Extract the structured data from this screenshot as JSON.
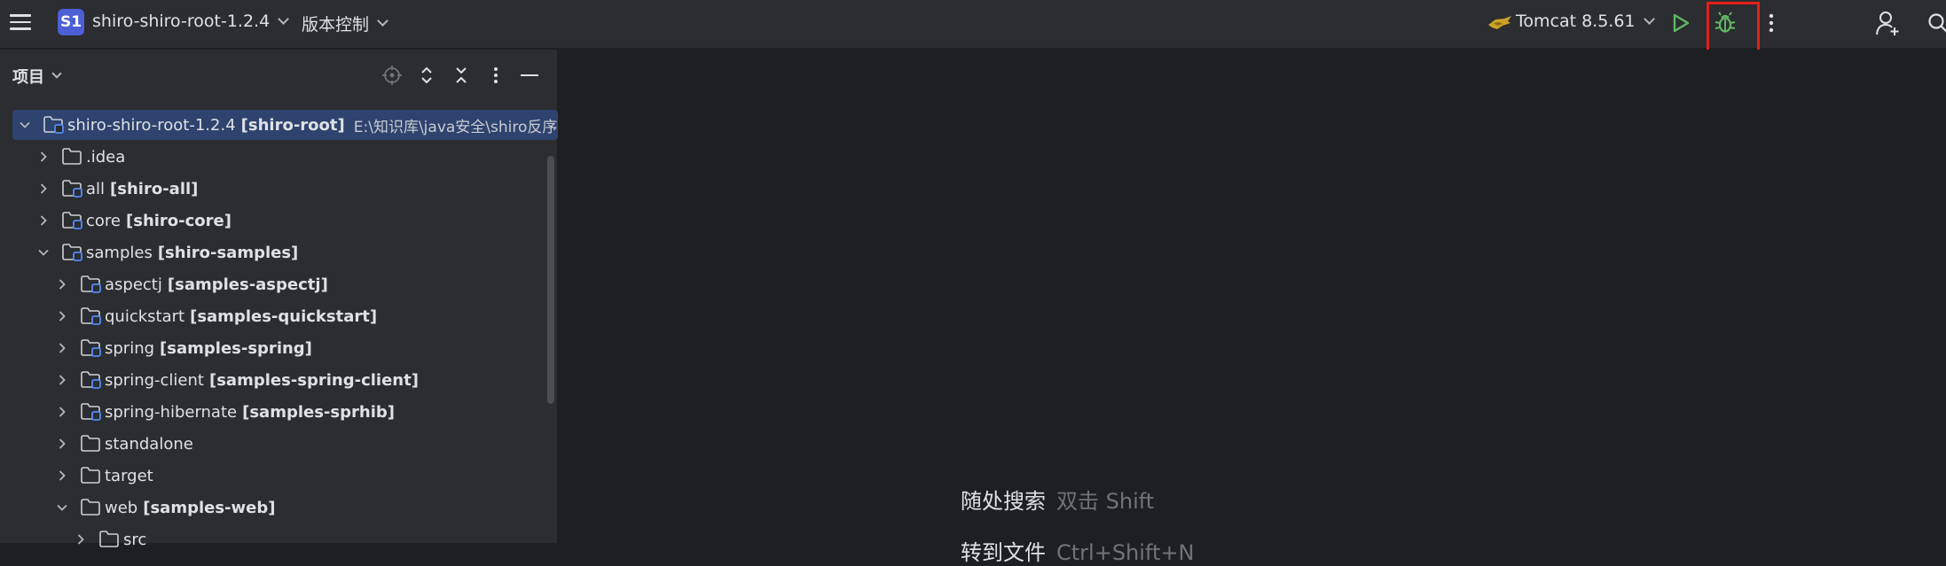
{
  "toolbar": {
    "menu_icon": "hamburger-icon",
    "project_badge": "S1",
    "project_name": "shiro-shiro-root-1.2.4",
    "vcs_label": "版本控制",
    "run_config": "Tomcat 8.5.61",
    "run_icon": "play-icon",
    "debug_icon": "bug-icon",
    "highlight_color": "#e2201a"
  },
  "panel": {
    "title": "项目"
  },
  "tree": [
    {
      "name": "shiro-shiro-root-1.2.4",
      "module": "[shiro-root]",
      "path": "E:\\知识库\\java安全\\shiro反序列",
      "expanded": true,
      "selected": true
    },
    {
      "name": ".idea",
      "module": "",
      "path": "",
      "expanded": false
    },
    {
      "name": "all",
      "module": "[shiro-all]",
      "path": "",
      "expanded": false
    },
    {
      "name": "core",
      "module": "[shiro-core]",
      "path": "",
      "expanded": false
    },
    {
      "name": "samples",
      "module": "[shiro-samples]",
      "path": "",
      "expanded": true
    },
    {
      "name": "aspectj",
      "module": "[samples-aspectj]",
      "path": "",
      "expanded": false
    },
    {
      "name": "quickstart",
      "module": "[samples-quickstart]",
      "path": "",
      "expanded": false
    },
    {
      "name": "spring",
      "module": "[samples-spring]",
      "path": "",
      "expanded": false
    },
    {
      "name": "spring-client",
      "module": "[samples-spring-client]",
      "path": "",
      "expanded": false
    },
    {
      "name": "spring-hibernate",
      "module": "[samples-sprhib]",
      "path": "",
      "expanded": false
    },
    {
      "name": "standalone",
      "module": "",
      "path": "",
      "expanded": false
    },
    {
      "name": "target",
      "module": "",
      "path": "",
      "expanded": false
    },
    {
      "name": "web",
      "module": "[samples-web]",
      "path": "",
      "expanded": true
    },
    {
      "name": "src",
      "module": "",
      "path": "",
      "expanded": false
    }
  ],
  "editor": {
    "hints": [
      {
        "label": "随处搜索",
        "shortcut": "双击 Shift"
      },
      {
        "label": "转到文件",
        "shortcut": "Ctrl+Shift+N"
      }
    ]
  }
}
